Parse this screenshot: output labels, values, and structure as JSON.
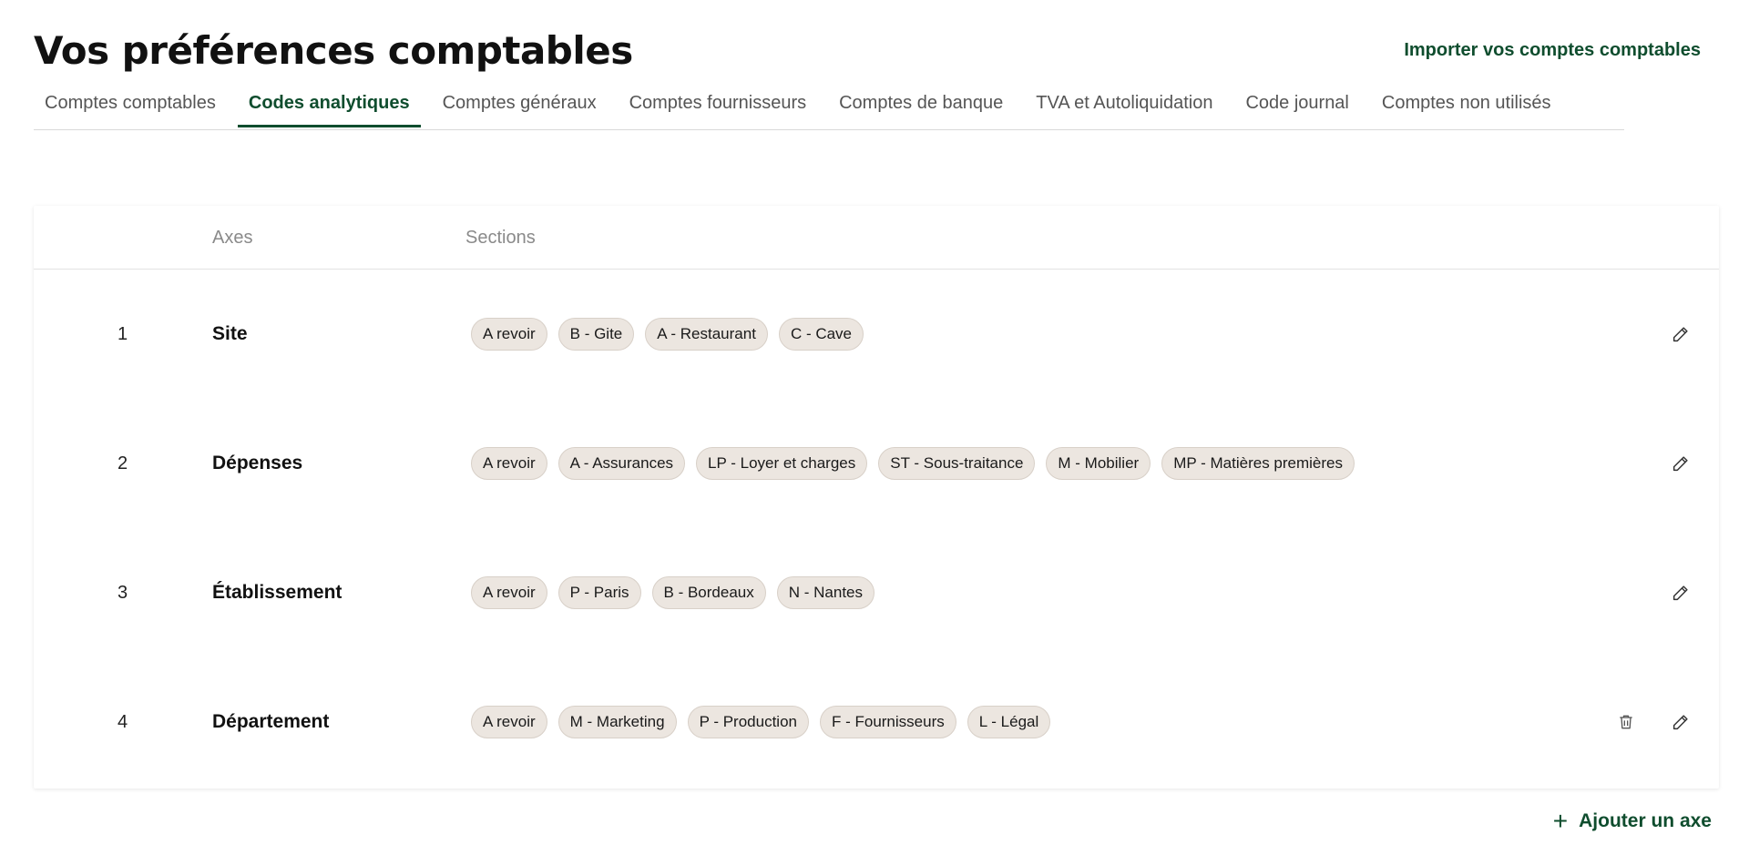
{
  "page": {
    "title": "Vos préférences comptables",
    "import_link": "Importer vos comptes comptables"
  },
  "tabs": [
    {
      "label": "Comptes comptables",
      "active": false
    },
    {
      "label": "Codes analytiques",
      "active": true
    },
    {
      "label": "Comptes généraux",
      "active": false
    },
    {
      "label": "Comptes fournisseurs",
      "active": false
    },
    {
      "label": "Comptes de banque",
      "active": false
    },
    {
      "label": "TVA et Autoliquidation",
      "active": false
    },
    {
      "label": "Code journal",
      "active": false
    },
    {
      "label": "Comptes non utilisés",
      "active": false
    }
  ],
  "table": {
    "headers": {
      "axes": "Axes",
      "sections": "Sections"
    },
    "rows": [
      {
        "num": "1",
        "name": "Site",
        "sections": [
          "A revoir",
          "B - Gite",
          "A - Restaurant",
          "C - Cave"
        ],
        "deletable": false
      },
      {
        "num": "2",
        "name": "Dépenses",
        "sections": [
          "A revoir",
          "A - Assurances",
          "LP - Loyer et charges",
          "ST - Sous-traitance",
          "M - Mobilier",
          "MP - Matières premières"
        ],
        "deletable": false
      },
      {
        "num": "3",
        "name": "Établissement",
        "sections": [
          "A revoir",
          "P - Paris",
          "B - Bordeaux",
          "N - Nantes"
        ],
        "deletable": false
      },
      {
        "num": "4",
        "name": "Département",
        "sections": [
          "A revoir",
          "M - Marketing",
          "P - Production",
          "F - Fournisseurs",
          "L - Légal"
        ],
        "deletable": true
      }
    ]
  },
  "add_axis": {
    "label": "Ajouter un axe",
    "icon": "plus-icon"
  },
  "icons": {
    "edit": "pencil-icon",
    "delete": "trash-icon"
  },
  "colors": {
    "accent": "#0f4d2e",
    "chip_bg": "#ece6e0",
    "muted": "#8a8a8a"
  }
}
